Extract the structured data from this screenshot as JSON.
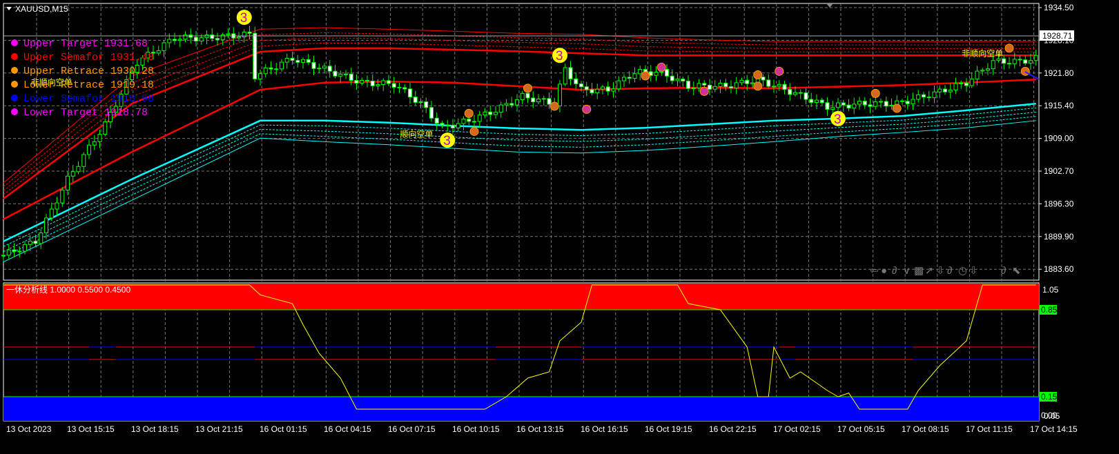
{
  "window": {
    "symbol_label": "XAUUSD,M15"
  },
  "legend": [
    {
      "label": "Upper Target   1931.68",
      "color": "#ff00ff"
    },
    {
      "label": "Upper Semafor  1931.48",
      "color": "#ff0000"
    },
    {
      "label": "Upper Retrace  1930.28",
      "color": "#ff9900"
    },
    {
      "label": "Lower Retrace  1919.18",
      "color": "#ff9900"
    },
    {
      "label": "Lower Semafor  1918.98",
      "color": "#0000ff"
    },
    {
      "label": "Lower Target   1918.78",
      "color": "#ff00ff"
    }
  ],
  "annotations": [
    {
      "text": "非顺向空单",
      "bar": 9,
      "price": 1919.4
    },
    {
      "text": "顺向空单",
      "bar": 78,
      "price": 1909.3
    },
    {
      "text": "非顺向空单",
      "bar": 183,
      "price": 1925.0
    }
  ],
  "current_price": "1928.71",
  "price_axis": [
    "1934.50",
    "1928.10",
    "1921.80",
    "1915.40",
    "1909.00",
    "1902.70",
    "1896.30",
    "1889.90",
    "1883.60"
  ],
  "osc_axis": {
    "top": "1.05",
    "upper": "0.85",
    "lower": "0.15",
    "bottom": "0.00",
    "bottom2": "0.05"
  },
  "osc_title": "一休分析线 1.0000 0.5500 0.4500",
  "time_axis": [
    "13 Oct 2023",
    "13 Oct 15:15",
    "13 Oct 18:15",
    "13 Oct 21:15",
    "16 Oct 01:15",
    "16 Oct 04:15",
    "16 Oct 07:15",
    "16 Oct 10:15",
    "16 Oct 13:15",
    "16 Oct 16:15",
    "16 Oct 19:15",
    "16 Oct 22:15",
    "17 Oct 02:15",
    "17 Oct 05:15",
    "17 Oct 08:15",
    "17 Oct 11:15",
    "17 Oct 14:15"
  ],
  "colors": {
    "bull": "#00ff00",
    "bear": "#ffffff",
    "red_band": "#ff0000",
    "cyan_band": "#00ffff",
    "osc_line": "#ffff00",
    "osc_red": "#ff0000",
    "osc_blue": "#0000ff",
    "level": "#00ff00"
  },
  "toolbar_icons": [
    "arrow-left-icon",
    "circle-icon",
    "loop-icon",
    "check-icon",
    "grid-icon",
    "arrow-upright-icon",
    "arrow-down-icon",
    "loop2-icon",
    "clock-icon",
    "arrow-down2-icon",
    "loop3-icon",
    "cursor-icon"
  ],
  "chart_data": {
    "type": "line",
    "band_bars": [
      0,
      24,
      48,
      60,
      72,
      84,
      96,
      108,
      120,
      132,
      144,
      156,
      168,
      180,
      193
    ],
    "bands": {
      "red_top": [
        1900.4,
        1921.2,
        1930.3,
        1930.6,
        1930.3,
        1929.9,
        1929.5,
        1929.3,
        1928.6,
        1928.2,
        1927.9,
        1927.9,
        1927.9,
        1927.9,
        1927.9
      ],
      "red_mid": [
        1897.3,
        1915.8,
        1925.9,
        1926.6,
        1926.6,
        1926.3,
        1926.0,
        1925.6,
        1925.2,
        1925.2,
        1925.2,
        1925.2,
        1925.2,
        1925.2,
        1925.2
      ],
      "red_low": [
        1893.3,
        1906.4,
        1918.5,
        1919.9,
        1920.1,
        1919.9,
        1919.2,
        1918.5,
        1918.8,
        1918.9,
        1918.8,
        1919.1,
        1919.4,
        1919.9,
        1920.5
      ],
      "cyan_top": [
        1889.0,
        1901.1,
        1912.5,
        1912.5,
        1912.1,
        1911.5,
        1911.0,
        1910.7,
        1911.1,
        1911.8,
        1912.5,
        1912.9,
        1913.4,
        1914.5,
        1915.8
      ],
      "cyan_low": [
        1885.0,
        1897.0,
        1909.1,
        1908.4,
        1907.8,
        1907.1,
        1906.4,
        1906.2,
        1906.7,
        1907.5,
        1908.4,
        1909.4,
        1910.2,
        1911.1,
        1912.5
      ]
    },
    "price_bars": [
      0,
      6,
      12,
      19,
      25,
      32,
      38,
      46,
      47,
      54,
      60,
      67,
      73,
      78,
      82,
      87,
      92,
      97,
      103,
      105,
      108,
      113,
      118,
      123,
      128,
      135,
      141,
      148,
      154,
      161,
      167,
      174,
      180,
      185,
      190,
      193
    ],
    "price_close": [
      1886.3,
      1889.0,
      1901.1,
      1911.8,
      1923.9,
      1928.6,
      1928.6,
      1929.3,
      1921.2,
      1924.6,
      1922.5,
      1919.9,
      1919.6,
      1915.8,
      1911.1,
      1912.5,
      1914.5,
      1917.2,
      1915.8,
      1922.5,
      1918.5,
      1918.5,
      1921.9,
      1921.9,
      1919.2,
      1919.2,
      1920.5,
      1917.8,
      1915.2,
      1915.8,
      1915.8,
      1917.8,
      1919.9,
      1924.0,
      1924.0,
      1924.6
    ],
    "markers": [
      {
        "bar": 45,
        "price": 1932.6,
        "kind": "big",
        "label": "3"
      },
      {
        "bar": 104,
        "price": 1925.2,
        "kind": "big",
        "label": "3"
      },
      {
        "bar": 83,
        "price": 1908.7,
        "kind": "big",
        "label": "3"
      },
      {
        "bar": 156,
        "price": 1912.9,
        "kind": "big",
        "label": "3"
      },
      {
        "bar": 98,
        "price": 1918.8,
        "kind": "orange"
      },
      {
        "bar": 103,
        "price": 1915.3,
        "kind": "orange"
      },
      {
        "bar": 87,
        "price": 1913.9,
        "kind": "orange"
      },
      {
        "bar": 88,
        "price": 1910.4,
        "kind": "orange"
      },
      {
        "bar": 120,
        "price": 1921.2,
        "kind": "orange"
      },
      {
        "bar": 141,
        "price": 1921.4,
        "kind": "orange"
      },
      {
        "bar": 141,
        "price": 1919.2,
        "kind": "orange"
      },
      {
        "bar": 163,
        "price": 1917.8,
        "kind": "orange"
      },
      {
        "bar": 167,
        "price": 1914.9,
        "kind": "orange"
      },
      {
        "bar": 188,
        "price": 1926.6,
        "kind": "orange"
      },
      {
        "bar": 191,
        "price": 1922.1,
        "kind": "orange"
      },
      {
        "bar": 109,
        "price": 1914.7,
        "kind": "magenta"
      },
      {
        "bar": 123,
        "price": 1922.9,
        "kind": "magenta"
      },
      {
        "bar": 131,
        "price": 1918.2,
        "kind": "magenta"
      },
      {
        "bar": 145,
        "price": 1922.1,
        "kind": "magenta"
      }
    ],
    "oscillator": {
      "bars": [
        0,
        46,
        48,
        54,
        56,
        59,
        63,
        66,
        90,
        94,
        98,
        102,
        104,
        108,
        110,
        126,
        128,
        134,
        139,
        141,
        143,
        144,
        147,
        149,
        154,
        156,
        158,
        160,
        169,
        171,
        175,
        180,
        183,
        193
      ],
      "values": [
        1.05,
        1.05,
        0.97,
        0.9,
        0.73,
        0.5,
        0.3,
        0.05,
        0.05,
        0.15,
        0.3,
        0.35,
        0.6,
        0.75,
        1.05,
        1.05,
        0.9,
        0.85,
        0.55,
        0.15,
        0.15,
        0.55,
        0.3,
        0.35,
        0.2,
        0.15,
        0.18,
        0.05,
        0.05,
        0.2,
        0.4,
        0.6,
        1.05,
        1.05
      ],
      "state_segments": [
        {
          "from": 0,
          "to": 16,
          "state": "red_top"
        },
        {
          "from": 16,
          "to": 21,
          "state": "blue_top"
        },
        {
          "from": 21,
          "to": 47,
          "state": "red_top"
        },
        {
          "from": 47,
          "to": 92,
          "state": "blue_top"
        },
        {
          "from": 92,
          "to": 108,
          "state": "red_top"
        },
        {
          "from": 108,
          "to": 145,
          "state": "blue_top"
        },
        {
          "from": 145,
          "to": 148,
          "state": "red_top"
        },
        {
          "from": 148,
          "to": 170,
          "state": "blue_top"
        },
        {
          "from": 170,
          "to": 193,
          "state": "red_top"
        }
      ],
      "levels": [
        0.85,
        0.55,
        0.45,
        0.15
      ]
    }
  }
}
